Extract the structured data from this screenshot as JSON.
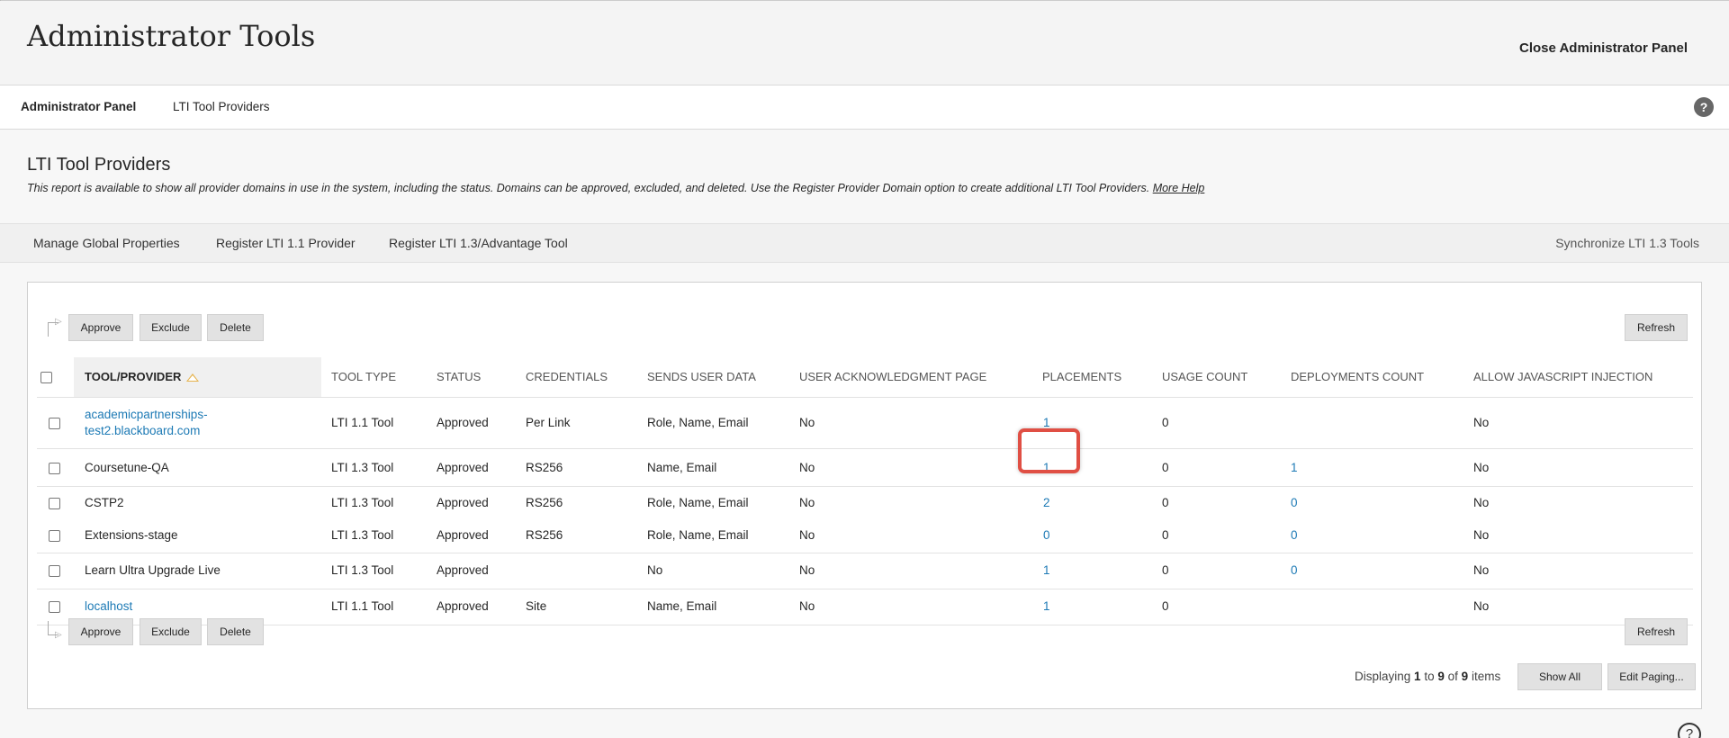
{
  "header": {
    "title": "Administrator Tools",
    "close_label": "Close Administrator Panel"
  },
  "breadcrumb": {
    "items": [
      "Administrator Panel",
      "LTI Tool Providers"
    ],
    "help_glyph": "?"
  },
  "section": {
    "title": "LTI Tool Providers",
    "description": "This report is available to show all provider domains in use in the system, including the status. Domains can be approved, excluded, and deleted. Use the Register Provider Domain option to create additional LTI Tool Providers.",
    "more_help": "More Help"
  },
  "action_bar": {
    "manage": "Manage Global Properties",
    "register_11": "Register LTI 1.1 Provider",
    "register_13": "Register LTI 1.3/Advantage Tool",
    "synchronize": "Synchronize LTI 1.3 Tools"
  },
  "buttons": {
    "approve": "Approve",
    "exclude": "Exclude",
    "delete": "Delete",
    "refresh": "Refresh",
    "show_all": "Show All",
    "edit_paging": "Edit Paging..."
  },
  "table": {
    "columns": {
      "tool": "TOOL/PROVIDER",
      "type": "TOOL TYPE",
      "status": "STATUS",
      "credentials": "CREDENTIALS",
      "sends": "SENDS USER DATA",
      "ack": "USER ACKNOWLEDGMENT PAGE",
      "placements": "PLACEMENTS",
      "usage": "USAGE COUNT",
      "deployments": "DEPLOYMENTS COUNT",
      "js": "ALLOW JAVASCRIPT INJECTION"
    },
    "rows": [
      {
        "tool": "academicpartnerships-test2.blackboard.com",
        "type": "LTI 1.1 Tool",
        "status": "Approved",
        "credentials": "Per Link",
        "sends": "Role, Name, Email",
        "ack": "No",
        "placements": "1",
        "usage": "0",
        "deployments": "",
        "js": "No"
      },
      {
        "tool": "Coursetune-QA",
        "type": "LTI 1.3 Tool",
        "status": "Approved",
        "credentials": "RS256",
        "sends": "Name, Email",
        "ack": "No",
        "placements": "1",
        "usage": "0",
        "deployments": "1",
        "js": "No"
      },
      {
        "tool": "CSTP2",
        "type": "LTI 1.3 Tool",
        "status": "Approved",
        "credentials": "RS256",
        "sends": "Role, Name, Email",
        "ack": "No",
        "placements": "2",
        "usage": "0",
        "deployments": "0",
        "js": "No"
      },
      {
        "tool": "Extensions-stage",
        "type": "LTI 1.3 Tool",
        "status": "Approved",
        "credentials": "RS256",
        "sends": "Role, Name, Email",
        "ack": "No",
        "placements": "0",
        "usage": "0",
        "deployments": "0",
        "js": "No"
      },
      {
        "tool": "Learn Ultra Upgrade Live",
        "type": "LTI 1.3 Tool",
        "status": "Approved",
        "credentials": "",
        "sends": "No",
        "ack": "No",
        "placements": "1",
        "usage": "0",
        "deployments": "0",
        "js": "No"
      },
      {
        "tool": "localhost",
        "type": "LTI 1.1 Tool",
        "status": "Approved",
        "credentials": "Site",
        "sends": "Name, Email",
        "ack": "No",
        "placements": "1",
        "usage": "0",
        "deployments": "",
        "js": "No"
      }
    ]
  },
  "paging": {
    "prefix": "Displaying",
    "from": "1",
    "to_word": "to",
    "to": "9",
    "of_word": "of",
    "total": "9",
    "suffix": "items"
  },
  "corner_help_glyph": "?"
}
